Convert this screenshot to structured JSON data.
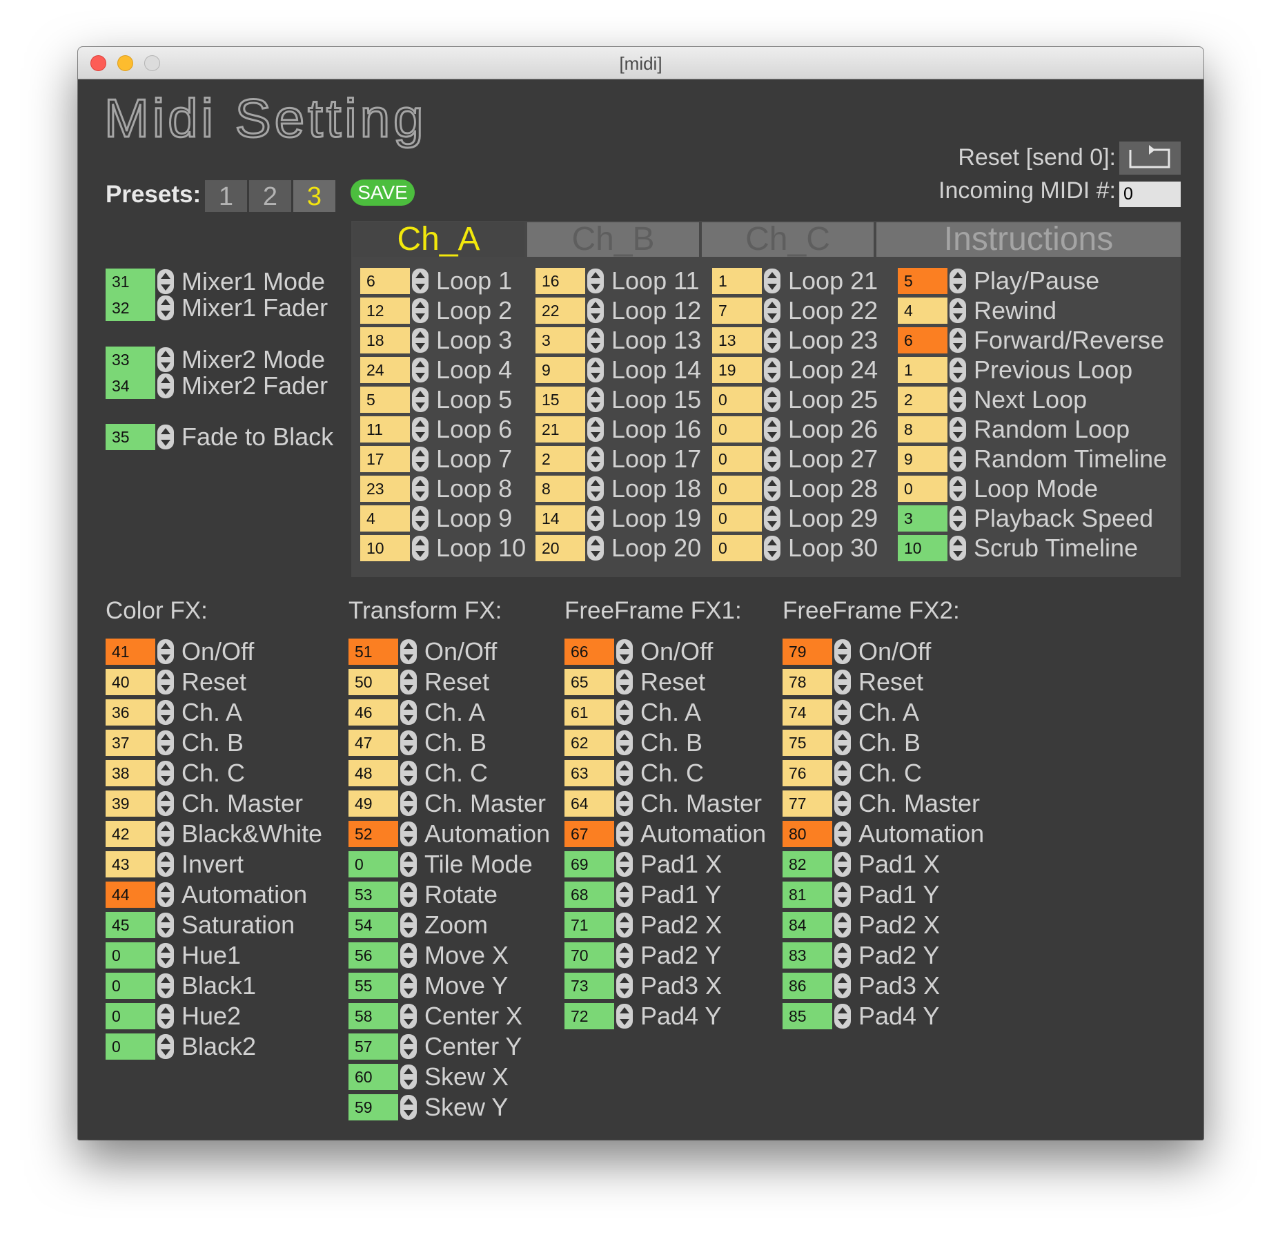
{
  "window": {
    "title": "[midi]"
  },
  "heading": "Midi Setting",
  "presets": {
    "label": "Presets:",
    "buttons": [
      "1",
      "2",
      "3"
    ],
    "active": "3",
    "save_label": "SAVE"
  },
  "reset": {
    "label": "Reset [send 0]:"
  },
  "incoming": {
    "label": "Incoming MIDI #:",
    "value": "0"
  },
  "mixer": [
    {
      "value": "31",
      "label": "Mixer1 Mode",
      "color": "g"
    },
    {
      "value": "32",
      "label": "Mixer1 Fader",
      "color": "g"
    },
    {
      "value": "33",
      "label": "Mixer2 Mode",
      "color": "g"
    },
    {
      "value": "34",
      "label": "Mixer2 Fader",
      "color": "g"
    },
    {
      "value": "35",
      "label": "Fade to Black",
      "color": "g"
    }
  ],
  "tabs": [
    "Ch_A",
    "Ch_B",
    "Ch_C",
    "Instructions"
  ],
  "active_tab": "Ch_A",
  "loops": [
    [
      {
        "value": "6",
        "label": "Loop 1",
        "color": "y"
      },
      {
        "value": "12",
        "label": "Loop 2",
        "color": "y"
      },
      {
        "value": "18",
        "label": "Loop 3",
        "color": "y"
      },
      {
        "value": "24",
        "label": "Loop 4",
        "color": "y"
      },
      {
        "value": "5",
        "label": "Loop 5",
        "color": "y"
      },
      {
        "value": "11",
        "label": "Loop 6",
        "color": "y"
      },
      {
        "value": "17",
        "label": "Loop 7",
        "color": "y"
      },
      {
        "value": "23",
        "label": "Loop 8",
        "color": "y"
      },
      {
        "value": "4",
        "label": "Loop 9",
        "color": "y"
      },
      {
        "value": "10",
        "label": "Loop 10",
        "color": "y"
      }
    ],
    [
      {
        "value": "16",
        "label": "Loop 11",
        "color": "y"
      },
      {
        "value": "22",
        "label": "Loop 12",
        "color": "y"
      },
      {
        "value": "3",
        "label": "Loop 13",
        "color": "y"
      },
      {
        "value": "9",
        "label": "Loop 14",
        "color": "y"
      },
      {
        "value": "15",
        "label": "Loop 15",
        "color": "y"
      },
      {
        "value": "21",
        "label": "Loop 16",
        "color": "y"
      },
      {
        "value": "2",
        "label": "Loop 17",
        "color": "y"
      },
      {
        "value": "8",
        "label": "Loop 18",
        "color": "y"
      },
      {
        "value": "14",
        "label": "Loop 19",
        "color": "y"
      },
      {
        "value": "20",
        "label": "Loop 20",
        "color": "y"
      }
    ],
    [
      {
        "value": "1",
        "label": "Loop 21",
        "color": "y"
      },
      {
        "value": "7",
        "label": "Loop 22",
        "color": "y"
      },
      {
        "value": "13",
        "label": "Loop 23",
        "color": "y"
      },
      {
        "value": "19",
        "label": "Loop 24",
        "color": "y"
      },
      {
        "value": "0",
        "label": "Loop 25",
        "color": "y"
      },
      {
        "value": "0",
        "label": "Loop 26",
        "color": "y"
      },
      {
        "value": "0",
        "label": "Loop 27",
        "color": "y"
      },
      {
        "value": "0",
        "label": "Loop 28",
        "color": "y"
      },
      {
        "value": "0",
        "label": "Loop 29",
        "color": "y"
      },
      {
        "value": "0",
        "label": "Loop 30",
        "color": "y"
      }
    ]
  ],
  "controls": [
    {
      "value": "5",
      "label": "Play/Pause",
      "color": "o"
    },
    {
      "value": "4",
      "label": "Rewind",
      "color": "y"
    },
    {
      "value": "6",
      "label": "Forward/Reverse",
      "color": "o"
    },
    {
      "value": "1",
      "label": "Previous Loop",
      "color": "y"
    },
    {
      "value": "2",
      "label": "Next Loop",
      "color": "y"
    },
    {
      "value": "8",
      "label": "Random Loop",
      "color": "y"
    },
    {
      "value": "9",
      "label": "Random Timeline",
      "color": "y"
    },
    {
      "value": "0",
      "label": "Loop Mode",
      "color": "y"
    },
    {
      "value": "3",
      "label": "Playback Speed",
      "color": "g"
    },
    {
      "value": "10",
      "label": "Scrub Timeline",
      "color": "g"
    }
  ],
  "fx": [
    {
      "title": "Color FX:",
      "items": [
        {
          "value": "41",
          "label": "On/Off",
          "color": "o"
        },
        {
          "value": "40",
          "label": "Reset",
          "color": "y"
        },
        {
          "value": "36",
          "label": "Ch. A",
          "color": "y"
        },
        {
          "value": "37",
          "label": "Ch. B",
          "color": "y"
        },
        {
          "value": "38",
          "label": "Ch. C",
          "color": "y"
        },
        {
          "value": "39",
          "label": "Ch. Master",
          "color": "y"
        },
        {
          "value": "42",
          "label": "Black&White",
          "color": "y"
        },
        {
          "value": "43",
          "label": "Invert",
          "color": "y"
        },
        {
          "value": "44",
          "label": "Automation",
          "color": "o"
        },
        {
          "value": "45",
          "label": "Saturation",
          "color": "g"
        },
        {
          "value": "0",
          "label": "Hue1",
          "color": "g"
        },
        {
          "value": "0",
          "label": "Black1",
          "color": "g"
        },
        {
          "value": "0",
          "label": "Hue2",
          "color": "g"
        },
        {
          "value": "0",
          "label": "Black2",
          "color": "g"
        }
      ]
    },
    {
      "title": "Transform FX:",
      "items": [
        {
          "value": "51",
          "label": "On/Off",
          "color": "o"
        },
        {
          "value": "50",
          "label": "Reset",
          "color": "y"
        },
        {
          "value": "46",
          "label": "Ch. A",
          "color": "y"
        },
        {
          "value": "47",
          "label": "Ch. B",
          "color": "y"
        },
        {
          "value": "48",
          "label": "Ch. C",
          "color": "y"
        },
        {
          "value": "49",
          "label": "Ch. Master",
          "color": "y"
        },
        {
          "value": "52",
          "label": "Automation",
          "color": "o"
        },
        {
          "value": "0",
          "label": "Tile Mode",
          "color": "g"
        },
        {
          "value": "53",
          "label": "Rotate",
          "color": "g"
        },
        {
          "value": "54",
          "label": "Zoom",
          "color": "g"
        },
        {
          "value": "56",
          "label": "Move X",
          "color": "g"
        },
        {
          "value": "55",
          "label": "Move Y",
          "color": "g"
        },
        {
          "value": "58",
          "label": "Center X",
          "color": "g"
        },
        {
          "value": "57",
          "label": "Center Y",
          "color": "g"
        },
        {
          "value": "60",
          "label": "Skew X",
          "color": "g"
        },
        {
          "value": "59",
          "label": "Skew Y",
          "color": "g"
        }
      ]
    },
    {
      "title": "FreeFrame FX1:",
      "items": [
        {
          "value": "66",
          "label": "On/Off",
          "color": "o"
        },
        {
          "value": "65",
          "label": "Reset",
          "color": "y"
        },
        {
          "value": "61",
          "label": "Ch. A",
          "color": "y"
        },
        {
          "value": "62",
          "label": "Ch. B",
          "color": "y"
        },
        {
          "value": "63",
          "label": "Ch. C",
          "color": "y"
        },
        {
          "value": "64",
          "label": "Ch. Master",
          "color": "y"
        },
        {
          "value": "67",
          "label": "Automation",
          "color": "o"
        },
        {
          "value": "69",
          "label": "Pad1 X",
          "color": "g"
        },
        {
          "value": "68",
          "label": "Pad1 Y",
          "color": "g"
        },
        {
          "value": "71",
          "label": "Pad2 X",
          "color": "g"
        },
        {
          "value": "70",
          "label": "Pad2 Y",
          "color": "g"
        },
        {
          "value": "73",
          "label": "Pad3 X",
          "color": "g"
        },
        {
          "value": "72",
          "label": "Pad4 Y",
          "color": "g"
        }
      ]
    },
    {
      "title": "FreeFrame FX2:",
      "items": [
        {
          "value": "79",
          "label": "On/Off",
          "color": "o"
        },
        {
          "value": "78",
          "label": "Reset",
          "color": "y"
        },
        {
          "value": "74",
          "label": "Ch. A",
          "color": "y"
        },
        {
          "value": "75",
          "label": "Ch. B",
          "color": "y"
        },
        {
          "value": "76",
          "label": "Ch. C",
          "color": "y"
        },
        {
          "value": "77",
          "label": "Ch. Master",
          "color": "y"
        },
        {
          "value": "80",
          "label": "Automation",
          "color": "o"
        },
        {
          "value": "82",
          "label": "Pad1 X",
          "color": "g"
        },
        {
          "value": "81",
          "label": "Pad1 Y",
          "color": "g"
        },
        {
          "value": "84",
          "label": "Pad2 X",
          "color": "g"
        },
        {
          "value": "83",
          "label": "Pad2 Y",
          "color": "g"
        },
        {
          "value": "86",
          "label": "Pad3 X",
          "color": "g"
        },
        {
          "value": "85",
          "label": "Pad4 Y",
          "color": "g"
        }
      ]
    }
  ]
}
